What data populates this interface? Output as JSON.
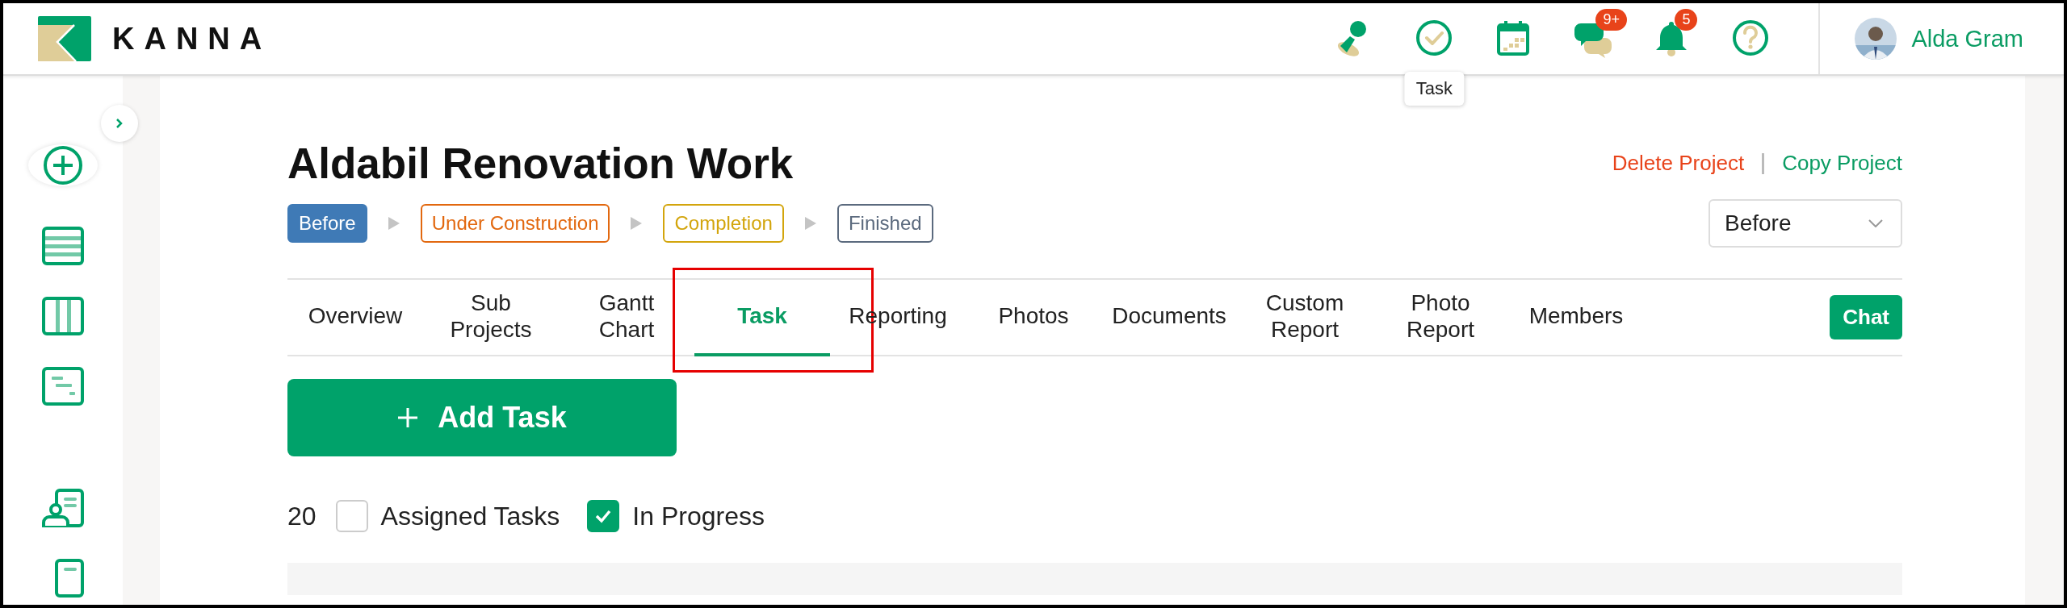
{
  "header": {
    "logo_text": "KANNA",
    "icons": [
      {
        "kind": "stamp"
      },
      {
        "kind": "task",
        "tooltip": "Task"
      },
      {
        "kind": "calendar"
      },
      {
        "kind": "chat",
        "badge": "9+"
      },
      {
        "kind": "bell",
        "badge": "5"
      },
      {
        "kind": "help"
      }
    ],
    "user": {
      "name": "Alda Gram"
    }
  },
  "sidebar": {
    "items": [
      {
        "kind": "add"
      },
      {
        "kind": "list"
      },
      {
        "kind": "board"
      },
      {
        "kind": "gantt"
      },
      {
        "kind": "divider"
      },
      {
        "kind": "person-doc"
      },
      {
        "kind": "doc"
      }
    ]
  },
  "project": {
    "title": "Aldabil Renovation Work",
    "actions": [
      {
        "label": "Delete Project",
        "kind": "danger"
      },
      {
        "label": "Copy Project",
        "kind": "primary"
      }
    ],
    "statuses": [
      {
        "label": "Before",
        "color": "#3f7ab6",
        "selected": true
      },
      {
        "label": "Under Construction",
        "color": "#e2680f",
        "selected": false
      },
      {
        "label": "Completion",
        "color": "#d3a50c",
        "selected": false
      },
      {
        "label": "Finished",
        "color": "#5b6a7e",
        "selected": false
      }
    ],
    "status_select": {
      "value": "Before"
    }
  },
  "tabs": [
    {
      "label": "Overview",
      "selected": false
    },
    {
      "label": "Sub\nProjects",
      "selected": false
    },
    {
      "label": "Gantt\nChart",
      "selected": false
    },
    {
      "label": "Task",
      "selected": true,
      "highlighted": true
    },
    {
      "label": "Reporting",
      "selected": false
    },
    {
      "label": "Photos",
      "selected": false
    },
    {
      "label": "Documents",
      "selected": false
    },
    {
      "label": "Custom\nReport",
      "selected": false
    },
    {
      "label": "Photo\nReport",
      "selected": false
    },
    {
      "label": "Members",
      "selected": false
    }
  ],
  "chat_button": {
    "label": "Chat"
  },
  "add_task_button": {
    "label": "Add Task"
  },
  "filter": {
    "count": "20",
    "checkboxes": [
      {
        "label": "Assigned Tasks",
        "checked": false
      },
      {
        "label": "In Progress",
        "checked": true
      }
    ]
  }
}
